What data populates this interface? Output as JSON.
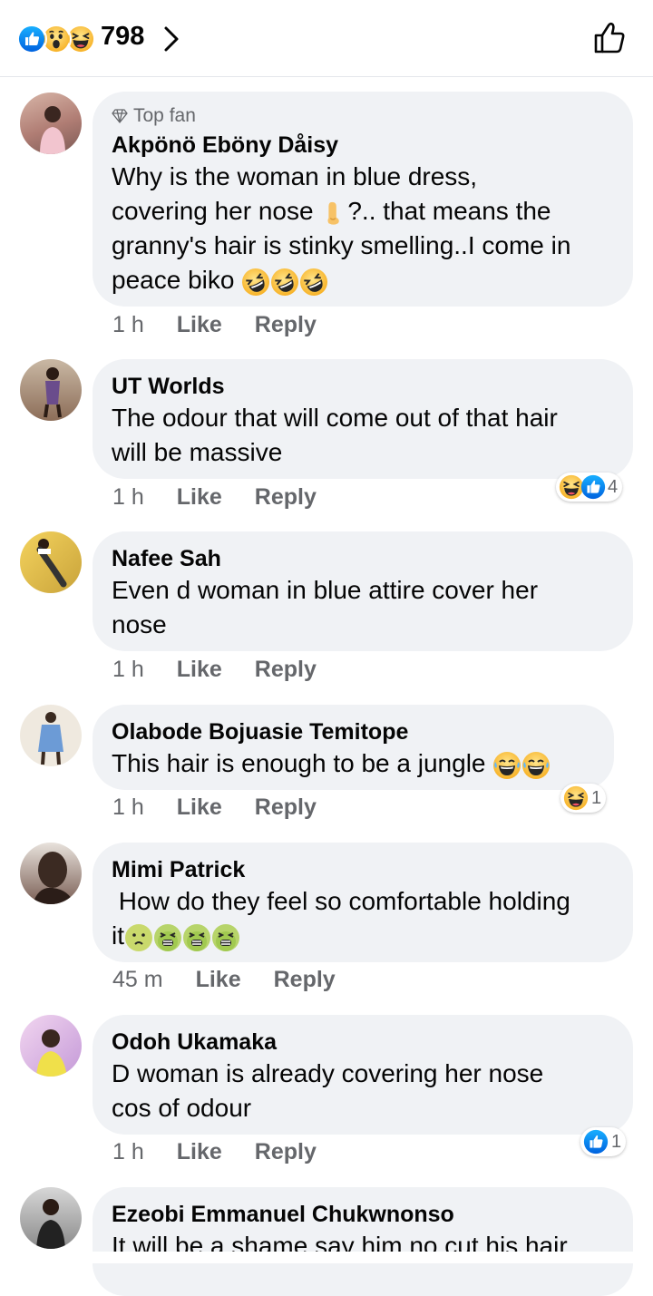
{
  "header": {
    "reaction_count": "798",
    "reaction_icons": [
      "like-icon",
      "wow-icon",
      "laugh-icon"
    ]
  },
  "comments": [
    {
      "badge": "Top fan",
      "name": "Akpönö Eböny Dåisy",
      "lines": [
        "Why is the woman in blue dress,",
        "covering her nose",
        "?.. that means the",
        "granny's hair is stinky smelling..I come in",
        "peace biko"
      ],
      "line2_end": "?.. that means the",
      "time": "1 h",
      "like": "Like",
      "reply": "Reply"
    },
    {
      "name": "UT Worlds",
      "text": "The odour that will come out of that hair\nwill be massive",
      "time": "1 h",
      "like": "Like",
      "reply": "Reply",
      "reactions": {
        "count": "4",
        "icons": [
          "laugh-icon",
          "like-icon"
        ]
      }
    },
    {
      "name": "Nafee Sah",
      "text": "Even d woman in blue attire cover her\nnose",
      "time": "1 h",
      "like": "Like",
      "reply": "Reply"
    },
    {
      "name": "Olabode Bojuasie Temitope",
      "text": "This hair is enough to be a jungle",
      "time": "1 h",
      "like": "Like",
      "reply": "Reply",
      "reactions": {
        "count": "1",
        "icons": [
          "laugh-icon"
        ]
      }
    },
    {
      "name": "Mimi Patrick",
      "text": " How do they feel so comfortable holding\nit",
      "time": "45 m",
      "like": "Like",
      "reply": "Reply"
    },
    {
      "name": "Odoh Ukamaka",
      "text": "D woman is already covering her nose\ncos of odour",
      "time": "1 h",
      "like": "Like",
      "reply": "Reply",
      "reactions": {
        "count": "1",
        "icons": [
          "like-icon"
        ]
      }
    },
    {
      "name": "Ezeobi Emmanuel Chukwnonso",
      "text": "It will be a shame say him no cut his hair"
    }
  ],
  "colors": {
    "like_blue": "#1877f2",
    "emoji_yellow": "#f7b125",
    "bubble": "#f0f2f5",
    "secondary_text": "#65676b"
  }
}
